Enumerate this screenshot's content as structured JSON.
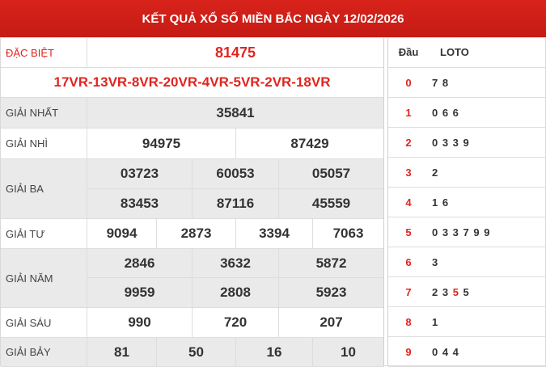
{
  "title": "KẾT QUẢ XỔ SỐ MIỀN BẮC NGÀY 12/02/2026",
  "prizes": {
    "special": {
      "label": "ĐẶC BIỆT",
      "value": "81475"
    },
    "codes": "17VR-13VR-8VR-20VR-4VR-5VR-2VR-18VR",
    "first": {
      "label": "GIẢI NHẤT",
      "values": [
        "35841"
      ]
    },
    "second": {
      "label": "GIẢI NHÌ",
      "values": [
        "94975",
        "87429"
      ]
    },
    "third": {
      "label": "GIẢI BA",
      "values": [
        "03723",
        "60053",
        "05057",
        "83453",
        "87116",
        "45559"
      ]
    },
    "fourth": {
      "label": "GIẢI TƯ",
      "values": [
        "9094",
        "2873",
        "3394",
        "7063"
      ]
    },
    "fifth": {
      "label": "GIẢI NĂM",
      "values": [
        "2846",
        "3632",
        "5872",
        "9959",
        "2808",
        "5923"
      ]
    },
    "sixth": {
      "label": "GIẢI SÁU",
      "values": [
        "990",
        "720",
        "207"
      ]
    },
    "seventh": {
      "label": "GIẢI BẢY",
      "values": [
        "81",
        "50",
        "16",
        "10"
      ]
    }
  },
  "loto": {
    "header_dau": "Đầu",
    "header_loto": "LOTO",
    "rows": [
      {
        "dau": "0",
        "loto": "7 8"
      },
      {
        "dau": "1",
        "loto": "0 6 6"
      },
      {
        "dau": "2",
        "loto": "0 3 3 9"
      },
      {
        "dau": "3",
        "loto": "2"
      },
      {
        "dau": "4",
        "loto": "1 6"
      },
      {
        "dau": "5",
        "loto": "0 3 3 7 9 9"
      },
      {
        "dau": "6",
        "loto": "3"
      },
      {
        "dau": "7",
        "loto": "2 3 5 5",
        "highlight_index": 2
      },
      {
        "dau": "8",
        "loto": "1"
      },
      {
        "dau": "9",
        "loto": "0 4 4"
      }
    ]
  },
  "colors": {
    "header_bg": "#d8231b",
    "accent_red": "#e0251e",
    "gray_bg": "#eaeaea"
  }
}
